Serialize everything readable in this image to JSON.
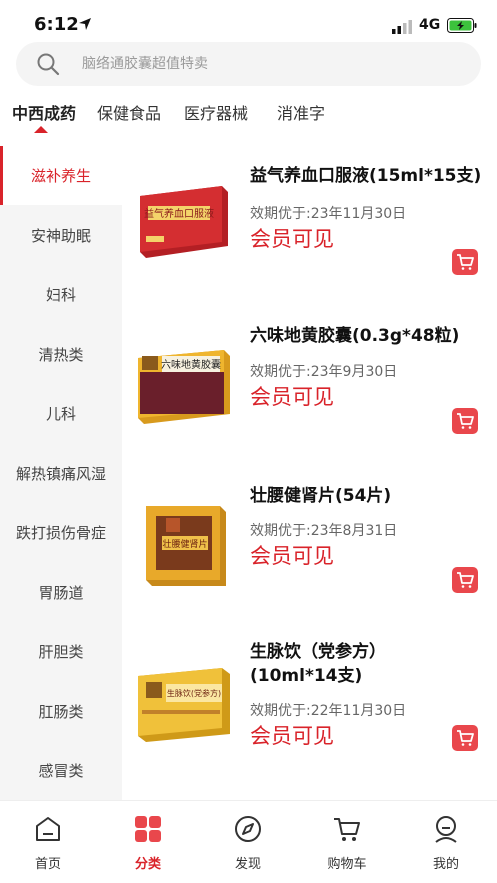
{
  "status_bar": {
    "time": "6:12",
    "network": "4G"
  },
  "search": {
    "placeholder": "脑络通胶囊超值特卖"
  },
  "top_tabs": [
    {
      "label": "中西成药",
      "active": true
    },
    {
      "label": "保健食品"
    },
    {
      "label": "医疗器械"
    },
    {
      "label": "消准字"
    }
  ],
  "sidebar": [
    {
      "label": "滋补养生",
      "active": true
    },
    {
      "label": "安神助眠"
    },
    {
      "label": "妇科"
    },
    {
      "label": "清热类"
    },
    {
      "label": "儿科"
    },
    {
      "label": "解热镇痛风湿"
    },
    {
      "label": "跌打损伤骨症"
    },
    {
      "label": "胃肠道"
    },
    {
      "label": "肝胆类"
    },
    {
      "label": "肛肠类"
    },
    {
      "label": "感冒类"
    }
  ],
  "products": [
    {
      "name": "益气养血口服液(15ml*15支)",
      "expiry": "效期优于:23年11月30日",
      "price": "会员可见",
      "box_label": "益气养血口服液",
      "box_color": "#c8262a"
    },
    {
      "name": "六味地黄胶囊(0.3g*48粒)",
      "expiry": "效期优于:23年9月30日",
      "price": "会员可见",
      "box_label": "六味地黄胶囊",
      "box_color": "#6a1f2b"
    },
    {
      "name": "壮腰健肾片(54片)",
      "expiry": "效期优于:23年8月31日",
      "price": "会员可见",
      "box_label": "壮腰健肾片",
      "box_color": "#e0a21c"
    },
    {
      "name_line1": "生脉饮（党参方）",
      "name_line2": "(10ml*14支)",
      "expiry": "效期优于:22年11月30日",
      "price": "会员可见",
      "box_label": "生脉饮(党参方)",
      "box_color": "#e8b321"
    }
  ],
  "bottom_nav": [
    {
      "label": "首页",
      "icon": "home-icon"
    },
    {
      "label": "分类",
      "icon": "category-icon",
      "active": true
    },
    {
      "label": "发现",
      "icon": "compass-icon"
    },
    {
      "label": "购物车",
      "icon": "cart-icon"
    },
    {
      "label": "我的",
      "icon": "profile-icon"
    }
  ],
  "colors": {
    "accent": "#d9232a",
    "cart_button": "#e9474c",
    "sidebar_bg": "#f5f5f5"
  }
}
